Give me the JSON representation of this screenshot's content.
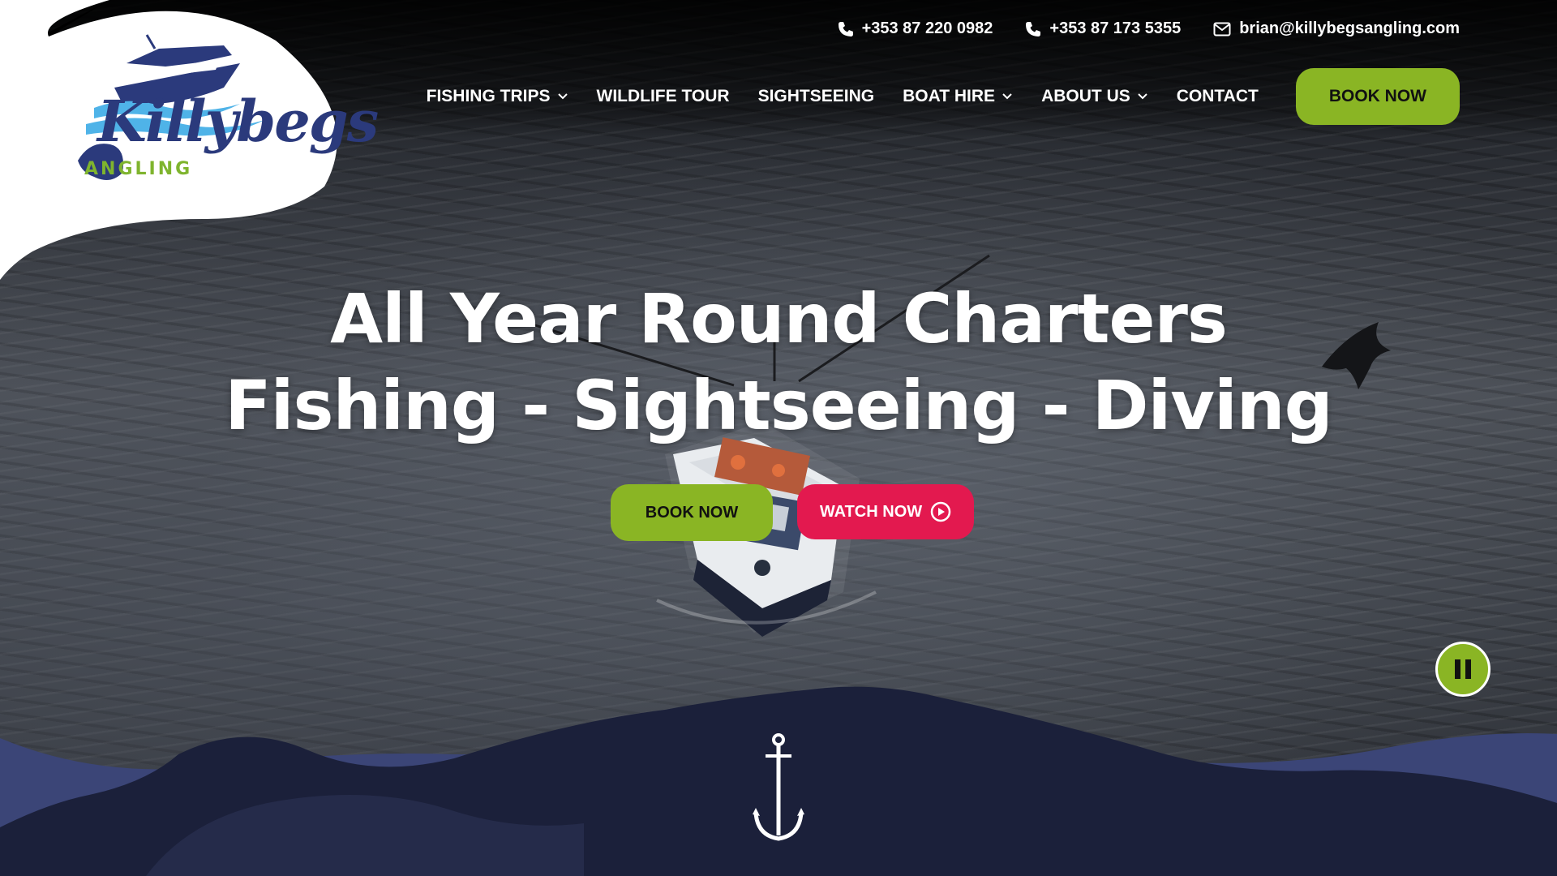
{
  "brand": {
    "name": "Killybegs",
    "sub": "ANGLING",
    "colors": {
      "navy": "#2b3a7c",
      "green": "#8ab524",
      "pink": "#e3194f",
      "wave_dark": "#1a1f36",
      "wave_mid": "#3b4577"
    }
  },
  "contact": {
    "phone1": "+353 87 220 0982",
    "phone2": "+353 87 173 5355",
    "email": "brian@killybegsangling.com",
    "phone_icon": "phone-icon",
    "email_icon": "envelope-icon"
  },
  "nav": {
    "items": [
      {
        "label": "FISHING TRIPS",
        "dropdown": true
      },
      {
        "label": "WILDLIFE TOUR",
        "dropdown": false
      },
      {
        "label": "SIGHTSEEING",
        "dropdown": false
      },
      {
        "label": "BOAT HIRE",
        "dropdown": true
      },
      {
        "label": "ABOUT US",
        "dropdown": true
      },
      {
        "label": "CONTACT",
        "dropdown": false
      }
    ],
    "book_label": "BOOK NOW"
  },
  "hero": {
    "line1": "All Year Round Charters",
    "line2": "Fishing - Sightseeing - Diving",
    "book_label": "BOOK NOW",
    "watch_label": "WATCH NOW",
    "watch_icon": "play-circle-icon",
    "pause_icon": "pause-icon",
    "anchor_icon": "anchor-icon"
  }
}
